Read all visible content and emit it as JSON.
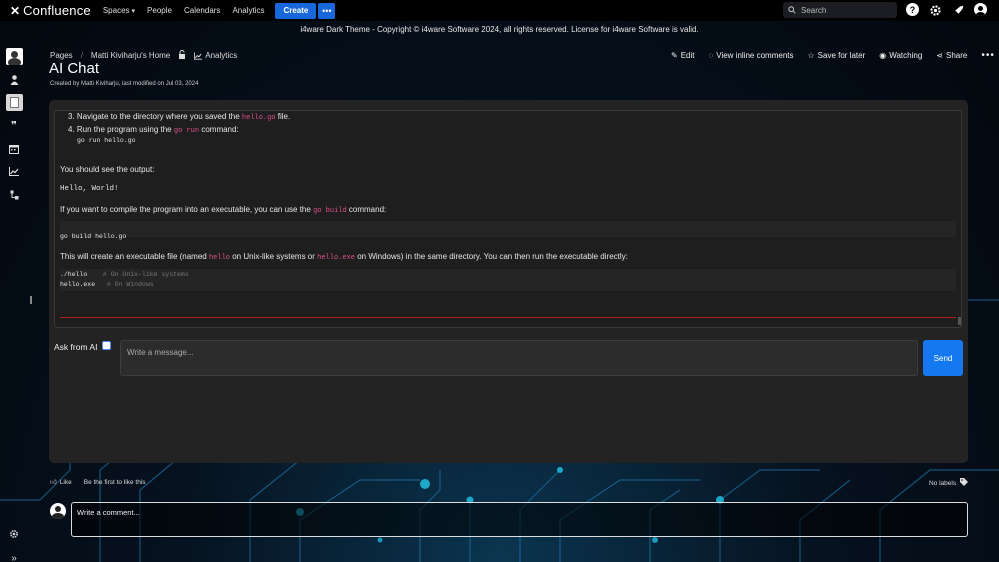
{
  "topnav": {
    "logo_mark": "✕",
    "logo_text": "Confluence",
    "items": [
      {
        "label": "Spaces",
        "has_chevron": true
      },
      {
        "label": "People"
      },
      {
        "label": "Calendars"
      },
      {
        "label": "Analytics"
      }
    ],
    "create_label": "Create",
    "more_label": "•••",
    "search_placeholder": "Search",
    "icons": [
      "help-icon",
      "settings-icon",
      "notifications-icon",
      "profile-avatar"
    ]
  },
  "banner": "i4ware Dark Theme - Copyright © i4ware Software 2024, all rights reserved. License for i4ware Software is valid.",
  "sidebar": {
    "icons": [
      "space-avatar",
      "person-icon",
      "page-icon",
      "quote-icon",
      "calendar-icon",
      "analytics-icon",
      "tree-icon"
    ],
    "bottom_icons": [
      "settings-icon",
      "expand-icon"
    ]
  },
  "breadcrumb": {
    "items": [
      "Pages",
      "Matti Kiviharju's Home"
    ],
    "analytics_label": "Analytics"
  },
  "page": {
    "title": "AI Chat",
    "byline": "Created by Matti Kiviharju, last modified on Jul 03, 2024"
  },
  "page_actions": {
    "edit": "Edit",
    "view_inline_comments": "View inline comments",
    "save_for_later": "Save for later",
    "watching": "Watching",
    "share": "Share",
    "more": "•••"
  },
  "chat": {
    "step3_prefix": "3.",
    "step3_text_a": "Navigate to the directory where you saved the",
    "step3_code": "hello.go",
    "step3_text_b": "file.",
    "step4_prefix": "4.",
    "step4_text_a": "Run the program using the",
    "step4_code": "go run",
    "step4_text_b": "command:",
    "step4_block": "go run hello.go",
    "output_intro": "You should see the output:",
    "output_block": "Hello, World!",
    "compile_text_a": "If you want to compile the program into an executable, you can use the",
    "compile_code": "go build",
    "compile_text_b": "command:",
    "compile_block": "go build hello.go",
    "exec_text_a": "This will create an executable file (named",
    "exec_code1": "hello",
    "exec_text_b": "on Unix-like systems or",
    "exec_code2": "hello.exe",
    "exec_text_c": "on Windows) in the same directory. You can then run the executable directly:",
    "run_line1_cmd": "./hello",
    "run_line1_comment": "# On Unix-like systems",
    "run_line2_cmd": "hello.exe",
    "run_line2_comment": "# On Windows"
  },
  "composer": {
    "ask_label": "Ask from AI",
    "ask_checked": false,
    "message_placeholder": "Write a message...",
    "send_label": "Send"
  },
  "footer": {
    "like_label": "Like",
    "like_note": "Be the first to like this",
    "labels_text": "No labels",
    "comment_placeholder": "Write a comment..."
  },
  "colors": {
    "accent": "#1868db",
    "send": "#1478f0",
    "code_inline": "#e0508e",
    "divider_red": "#b01e1e"
  }
}
